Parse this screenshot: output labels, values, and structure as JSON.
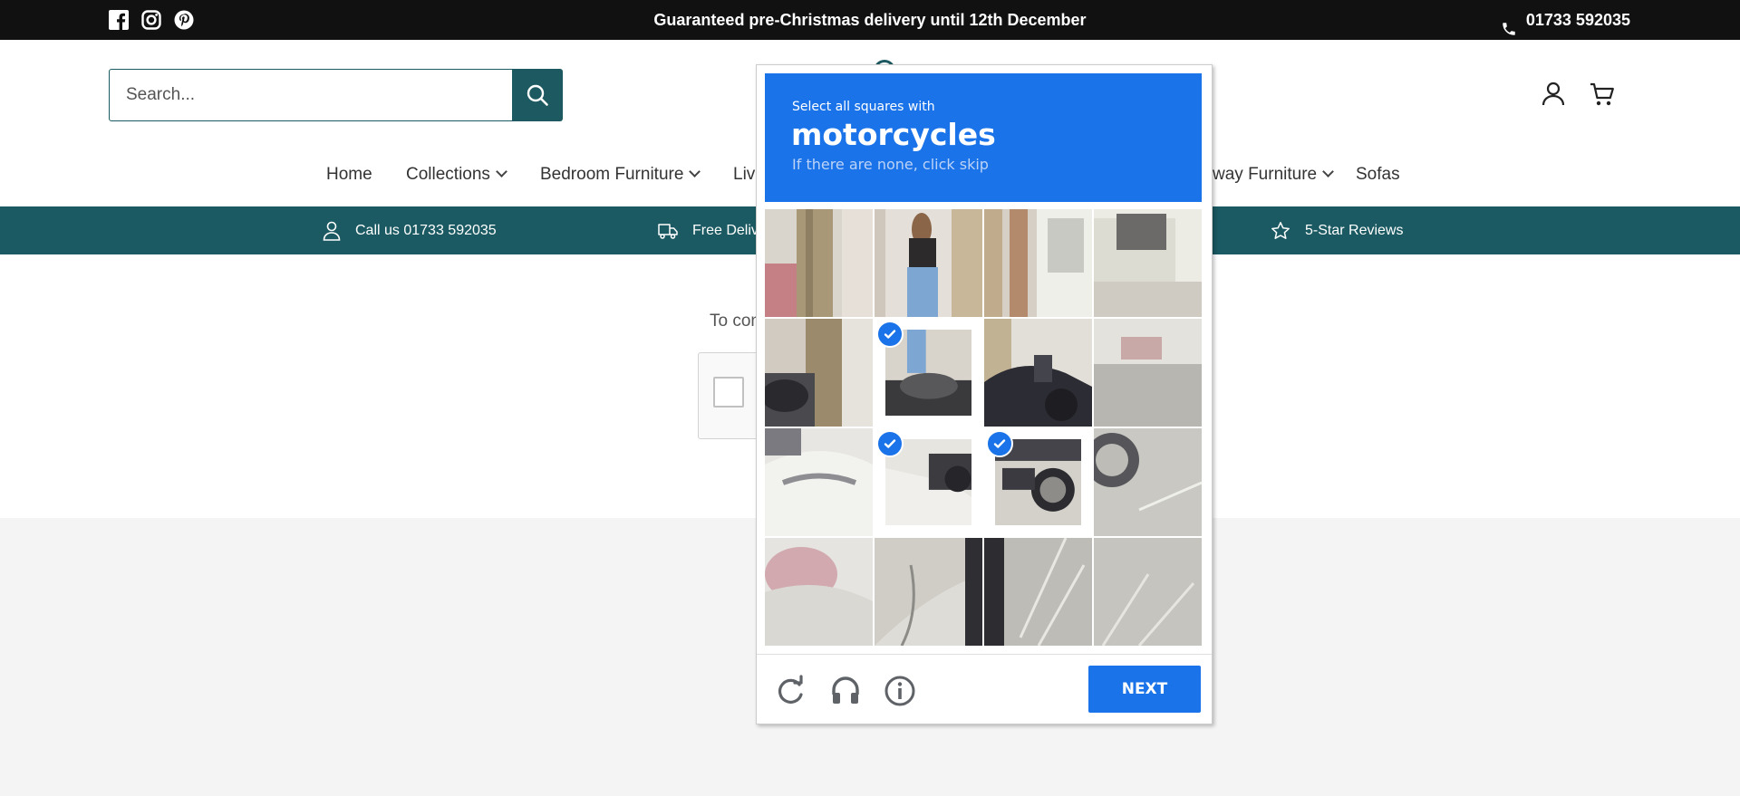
{
  "topbar": {
    "announcement": "Guaranteed pre-Christmas delivery until 12th December",
    "phone": "01733 592035",
    "social_icons": [
      "facebook-icon",
      "instagram-icon",
      "pinterest-icon"
    ]
  },
  "header": {
    "search_placeholder": "Search...",
    "icons": [
      "account-icon",
      "cart-icon"
    ]
  },
  "nav": {
    "items": [
      {
        "label": "Home",
        "has_dropdown": false
      },
      {
        "label": "Collections",
        "has_dropdown": true
      },
      {
        "label": "Bedroom Furniture",
        "has_dropdown": true
      },
      {
        "label": "Liv",
        "has_dropdown": false
      },
      {
        "label": "way Furniture",
        "has_dropdown": true
      },
      {
        "label": "Sofas",
        "has_dropdown": false
      }
    ]
  },
  "usp": {
    "items": [
      {
        "icon": "user-icon",
        "label": "Call us 01733 592035"
      },
      {
        "icon": "truck-icon",
        "label": "Free Delive"
      },
      {
        "icon": "star-icon",
        "label": "5-Star Reviews"
      }
    ]
  },
  "content": {
    "partial_text": "To con"
  },
  "captcha": {
    "instruction_small": "Select all squares with",
    "target": "motorcycles",
    "instruction_sub": "If there are none, click skip",
    "grid_size": 4,
    "selected_tiles": [
      5,
      9,
      10
    ],
    "next_label": "NEXT",
    "footer_icons": [
      "reload-icon",
      "audio-icon",
      "info-icon"
    ],
    "accent_color": "#1a73e8"
  },
  "colors": {
    "teal": "#1b5a62",
    "topbar": "#111111",
    "footer_bg": "#f4f4f4"
  }
}
